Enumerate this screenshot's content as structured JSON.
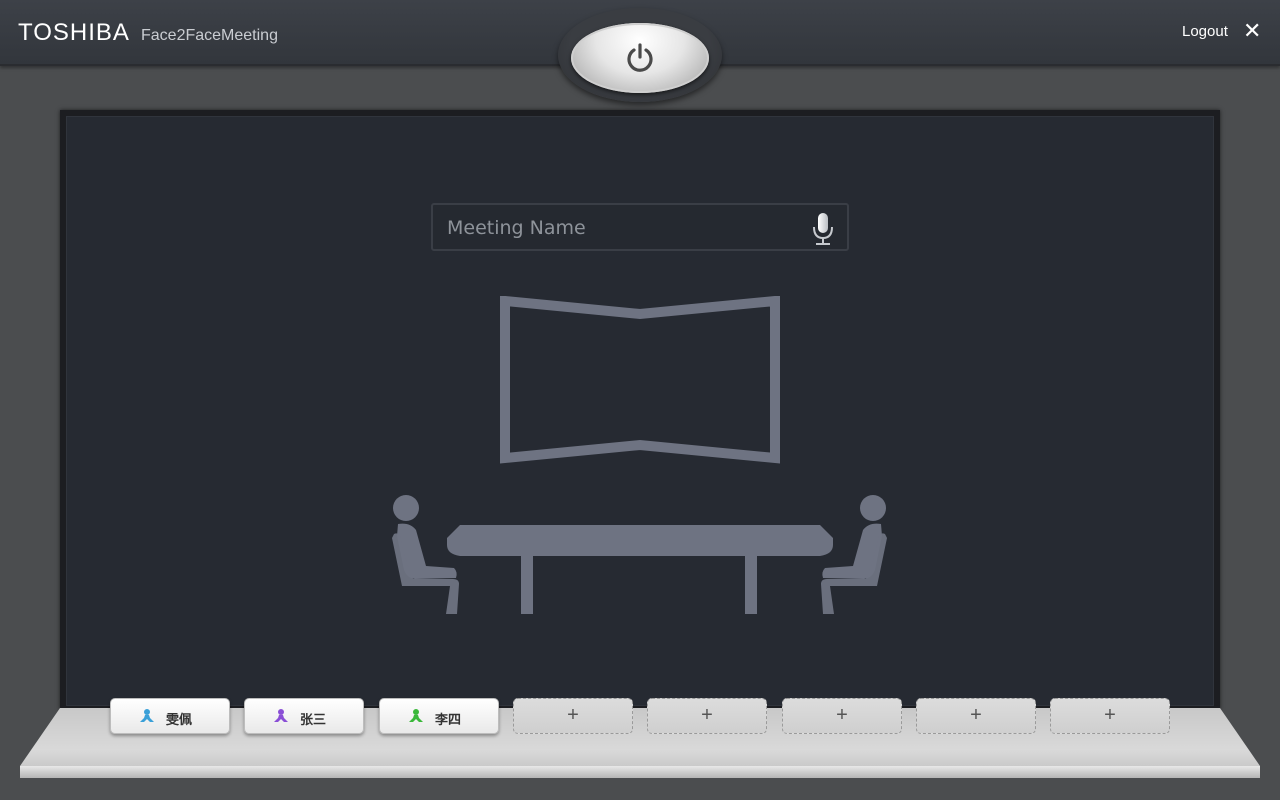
{
  "header": {
    "brand": "TOSHIBA",
    "app_name": "Face2FaceMeeting",
    "logout_label": "Logout",
    "close_glyph": "✕"
  },
  "power_button": {
    "icon": "power-icon"
  },
  "meeting": {
    "placeholder": "Meeting Name",
    "mic_icon": "microphone-icon"
  },
  "participants": [
    {
      "name": "雯佩",
      "icon_color": "#3aa0d8"
    },
    {
      "name": "张三",
      "icon_color": "#8a4fd6"
    },
    {
      "name": "李四",
      "icon_color": "#3ab83a"
    }
  ],
  "empty_slot_label": "+",
  "colors": {
    "room_bg": "#262a32",
    "illustration": "#6e7382"
  }
}
